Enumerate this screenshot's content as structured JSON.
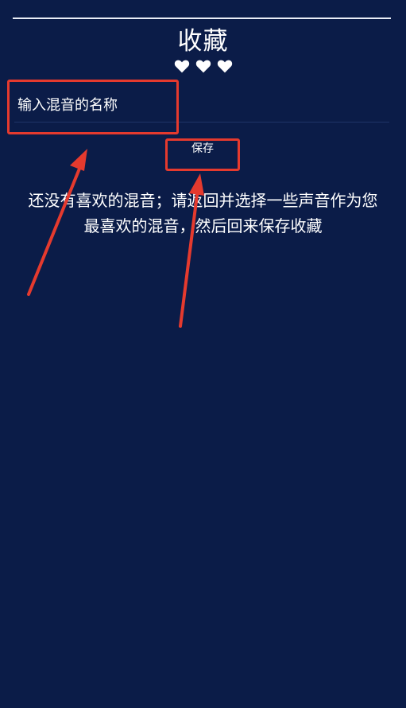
{
  "header": {
    "title": "收藏",
    "hearts": [
      "heart-icon",
      "heart-icon",
      "heart-icon"
    ]
  },
  "favorite_form": {
    "name_placeholder": "输入混音的名称",
    "name_value": "",
    "save_label": "保存"
  },
  "empty_state": {
    "line1": "还没有喜欢的混音；请返回并选择一些声音作为您",
    "line2": "最喜欢的混音，然后回来保存收藏"
  },
  "colors": {
    "background": "#0b1c48",
    "text": "#ffffff",
    "annotation": "#e53a2e"
  }
}
